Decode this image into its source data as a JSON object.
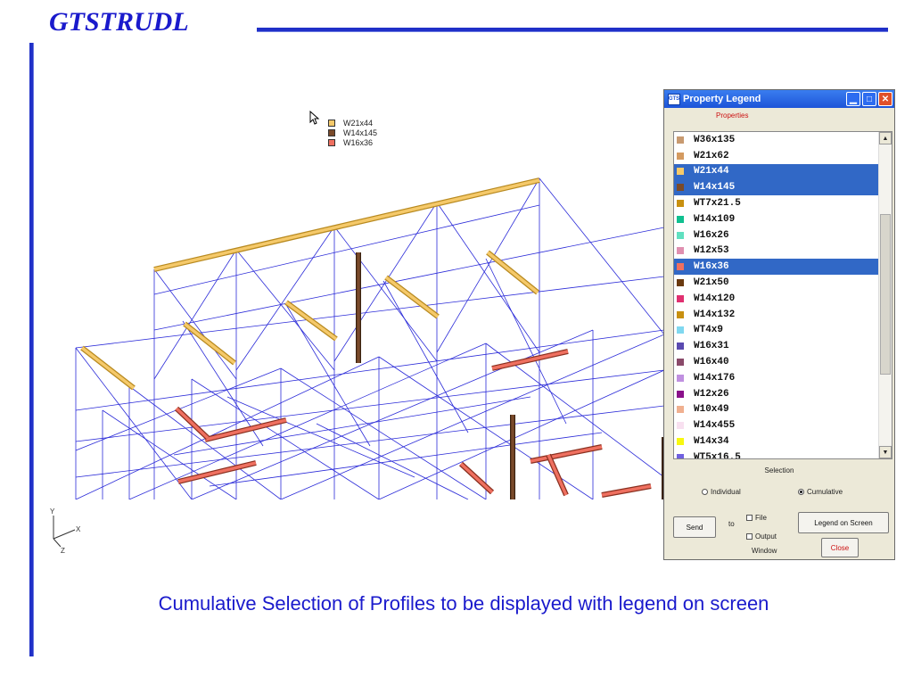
{
  "slide": {
    "title": "GTSTRUDL",
    "caption": "Cumulative Selection of Profiles to be displayed with legend on screen"
  },
  "viewport_legend": [
    {
      "label": "W21x44",
      "color": "#f5c96a"
    },
    {
      "label": "W14x145",
      "color": "#7a4a2a"
    },
    {
      "label": "W16x36",
      "color": "#ef7060"
    }
  ],
  "axis": {
    "y": "Y",
    "x": "X",
    "z": "Z"
  },
  "dialog": {
    "app_icon": "GTS",
    "title": "Property Legend",
    "subtitle": "Properties",
    "minimize_icon": "minimize-icon",
    "maximize_icon": "maximize-icon",
    "close_icon": "close-icon",
    "items": [
      {
        "label": "W36x135",
        "color": "#c89a70",
        "selected": false
      },
      {
        "label": "W21x62",
        "color": "#d49a60",
        "selected": false
      },
      {
        "label": "W21x44",
        "color": "#f5c96a",
        "selected": true
      },
      {
        "label": "W14x145",
        "color": "#7a4a2a",
        "selected": true
      },
      {
        "label": "WT7x21.5",
        "color": "#c89010",
        "selected": false
      },
      {
        "label": "W14x109",
        "color": "#10c090",
        "selected": false
      },
      {
        "label": "W16x26",
        "color": "#60e0c0",
        "selected": false
      },
      {
        "label": "W12x53",
        "color": "#e090b0",
        "selected": false
      },
      {
        "label": "W16x36",
        "color": "#ef7060",
        "selected": true
      },
      {
        "label": "W21x50",
        "color": "#6a3a10",
        "selected": false
      },
      {
        "label": "W14x120",
        "color": "#e03070",
        "selected": false
      },
      {
        "label": "W14x132",
        "color": "#c89010",
        "selected": false
      },
      {
        "label": "WT4x9",
        "color": "#80d8f0",
        "selected": false
      },
      {
        "label": "W16x31",
        "color": "#5a4ab0",
        "selected": false
      },
      {
        "label": "W16x40",
        "color": "#8a4a6a",
        "selected": false
      },
      {
        "label": "W14x176",
        "color": "#c090e0",
        "selected": false
      },
      {
        "label": "W12x26",
        "color": "#8a108a",
        "selected": false
      },
      {
        "label": "W10x49",
        "color": "#f0b090",
        "selected": false
      },
      {
        "label": "W14x455",
        "color": "#f8e0f0",
        "selected": false
      },
      {
        "label": "W14x34",
        "color": "#f8f810",
        "selected": false
      },
      {
        "label": "WT5x16.5",
        "color": "#7060e0",
        "selected": false
      }
    ],
    "selection_label": "Selection",
    "radio_individual": "Individual",
    "radio_cumulative": "Cumulative",
    "selection_mode": "Cumulative",
    "send_label": "Send",
    "to_label": "to",
    "file_label": "File",
    "output_label": "Output",
    "window_label": "Window",
    "legend_on_screen_label": "Legend on Screen",
    "close_label": "Close"
  }
}
